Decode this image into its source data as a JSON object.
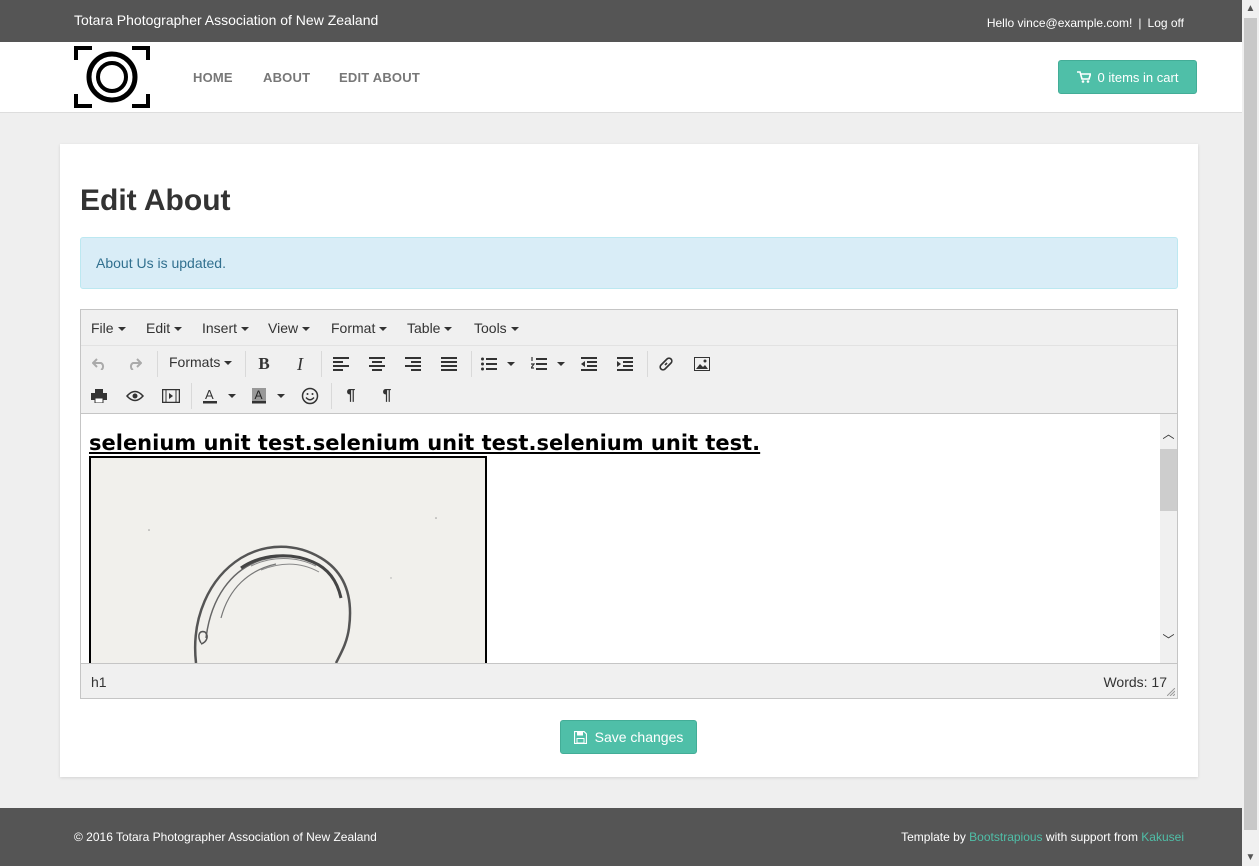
{
  "header": {
    "site_title": "Totara Photographer Association of New Zealand",
    "greeting": "Hello vince@example.com!",
    "separator": "|",
    "logoff": "Log off"
  },
  "nav": {
    "items": [
      {
        "label": "HOME"
      },
      {
        "label": "ABOUT"
      },
      {
        "label": "EDIT ABOUT"
      }
    ],
    "cart_label": "0 items in cart"
  },
  "main": {
    "title": "Edit About",
    "alert": "About Us is updated.",
    "save_label": "Save changes"
  },
  "editor": {
    "menu": [
      {
        "label": "File"
      },
      {
        "label": "Edit"
      },
      {
        "label": "Insert"
      },
      {
        "label": "View"
      },
      {
        "label": "Format"
      },
      {
        "label": "Table"
      },
      {
        "label": "Tools"
      }
    ],
    "formats_label": "Formats",
    "content_heading": "selenium unit test.selenium unit test.selenium unit test.",
    "path": "h1",
    "wordcount": "Words: 17"
  },
  "footer": {
    "copyright": "© 2016 Totara Photographer Association of New Zealand",
    "template_by": "Template by",
    "template_link": "Bootstrapious",
    "support_text": "with support from",
    "support_link": "Kakusei"
  },
  "colors": {
    "accent": "#4fbfa8",
    "bar": "#555555",
    "alert_bg": "#d9edf7",
    "alert_text": "#31708f"
  },
  "icons": {
    "toolbar_row1": [
      "undo-icon",
      "redo-icon",
      "bold-icon",
      "italic-icon",
      "align-left-icon",
      "align-center-icon",
      "align-right-icon",
      "align-justify-icon",
      "bullet-list-icon",
      "numbered-list-icon",
      "outdent-icon",
      "indent-icon",
      "link-icon",
      "image-icon"
    ],
    "toolbar_row2": [
      "print-icon",
      "preview-icon",
      "media-icon",
      "text-color-icon",
      "background-color-icon",
      "emoticons-icon",
      "ltr-icon",
      "rtl-icon"
    ]
  }
}
